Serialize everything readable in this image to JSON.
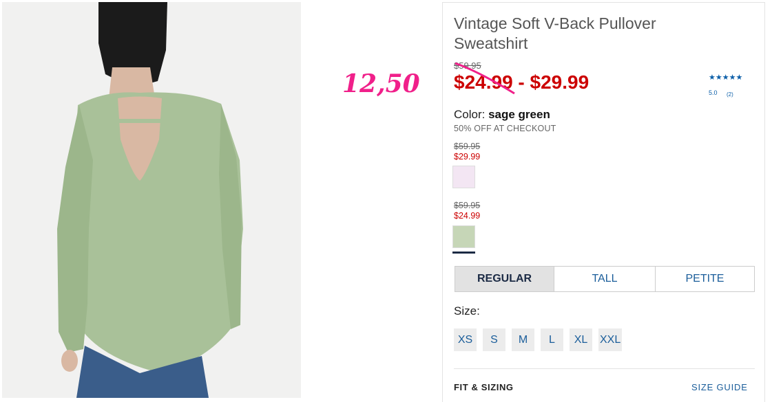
{
  "product": {
    "title": "Vintage Soft V-Back Pullover Sweatshirt",
    "original_price": "$59.95",
    "price_low": "$24.99",
    "price_sep": " - ",
    "price_high": "$29.99",
    "rating_stars": "★★★★★",
    "rating_value": "5.0",
    "rating_count": "(2)"
  },
  "annotation": {
    "text": "12,50",
    "color": "#f0208a"
  },
  "color": {
    "label": "Color: ",
    "selected": "sage green",
    "promo": "50% OFF AT CHECKOUT"
  },
  "swatches": [
    {
      "original": "$59.95",
      "sale": "$29.99",
      "color": "#f3e6f3"
    },
    {
      "original": "$59.95",
      "sale": "$24.99",
      "color": "#c6d6b7",
      "selected": true
    }
  ],
  "fit_tabs": [
    {
      "label": "REGULAR",
      "active": true
    },
    {
      "label": "TALL",
      "active": false
    },
    {
      "label": "PETITE",
      "active": false
    }
  ],
  "size": {
    "label": "Size:",
    "options": [
      "XS",
      "S",
      "M",
      "L",
      "XL",
      "XXL"
    ]
  },
  "footer": {
    "fit_sizing": "FIT & SIZING",
    "size_guide": "SIZE GUIDE"
  },
  "colors": {
    "sale_red": "#cc0000",
    "link_blue": "#1a5d9a",
    "navy": "#1b2a44",
    "sweatshirt": "#a9c199"
  }
}
